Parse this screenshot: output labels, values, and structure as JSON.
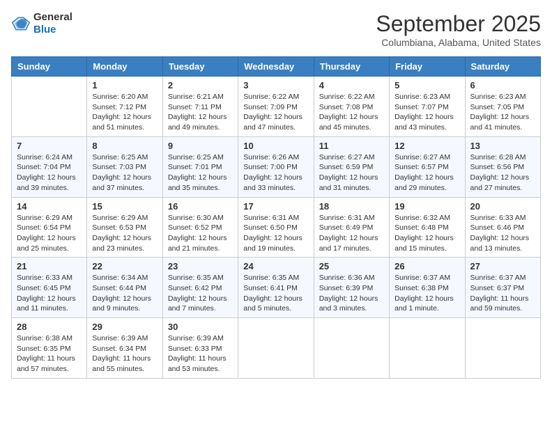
{
  "header": {
    "logo_line1": "General",
    "logo_line2": "Blue",
    "month_title": "September 2025",
    "location": "Columbiana, Alabama, United States"
  },
  "days_of_week": [
    "Sunday",
    "Monday",
    "Tuesday",
    "Wednesday",
    "Thursday",
    "Friday",
    "Saturday"
  ],
  "weeks": [
    [
      {
        "day": "",
        "info": ""
      },
      {
        "day": "1",
        "info": "Sunrise: 6:20 AM\nSunset: 7:12 PM\nDaylight: 12 hours\nand 51 minutes."
      },
      {
        "day": "2",
        "info": "Sunrise: 6:21 AM\nSunset: 7:11 PM\nDaylight: 12 hours\nand 49 minutes."
      },
      {
        "day": "3",
        "info": "Sunrise: 6:22 AM\nSunset: 7:09 PM\nDaylight: 12 hours\nand 47 minutes."
      },
      {
        "day": "4",
        "info": "Sunrise: 6:22 AM\nSunset: 7:08 PM\nDaylight: 12 hours\nand 45 minutes."
      },
      {
        "day": "5",
        "info": "Sunrise: 6:23 AM\nSunset: 7:07 PM\nDaylight: 12 hours\nand 43 minutes."
      },
      {
        "day": "6",
        "info": "Sunrise: 6:23 AM\nSunset: 7:05 PM\nDaylight: 12 hours\nand 41 minutes."
      }
    ],
    [
      {
        "day": "7",
        "info": "Sunrise: 6:24 AM\nSunset: 7:04 PM\nDaylight: 12 hours\nand 39 minutes."
      },
      {
        "day": "8",
        "info": "Sunrise: 6:25 AM\nSunset: 7:03 PM\nDaylight: 12 hours\nand 37 minutes."
      },
      {
        "day": "9",
        "info": "Sunrise: 6:25 AM\nSunset: 7:01 PM\nDaylight: 12 hours\nand 35 minutes."
      },
      {
        "day": "10",
        "info": "Sunrise: 6:26 AM\nSunset: 7:00 PM\nDaylight: 12 hours\nand 33 minutes."
      },
      {
        "day": "11",
        "info": "Sunrise: 6:27 AM\nSunset: 6:59 PM\nDaylight: 12 hours\nand 31 minutes."
      },
      {
        "day": "12",
        "info": "Sunrise: 6:27 AM\nSunset: 6:57 PM\nDaylight: 12 hours\nand 29 minutes."
      },
      {
        "day": "13",
        "info": "Sunrise: 6:28 AM\nSunset: 6:56 PM\nDaylight: 12 hours\nand 27 minutes."
      }
    ],
    [
      {
        "day": "14",
        "info": "Sunrise: 6:29 AM\nSunset: 6:54 PM\nDaylight: 12 hours\nand 25 minutes."
      },
      {
        "day": "15",
        "info": "Sunrise: 6:29 AM\nSunset: 6:53 PM\nDaylight: 12 hours\nand 23 minutes."
      },
      {
        "day": "16",
        "info": "Sunrise: 6:30 AM\nSunset: 6:52 PM\nDaylight: 12 hours\nand 21 minutes."
      },
      {
        "day": "17",
        "info": "Sunrise: 6:31 AM\nSunset: 6:50 PM\nDaylight: 12 hours\nand 19 minutes."
      },
      {
        "day": "18",
        "info": "Sunrise: 6:31 AM\nSunset: 6:49 PM\nDaylight: 12 hours\nand 17 minutes."
      },
      {
        "day": "19",
        "info": "Sunrise: 6:32 AM\nSunset: 6:48 PM\nDaylight: 12 hours\nand 15 minutes."
      },
      {
        "day": "20",
        "info": "Sunrise: 6:33 AM\nSunset: 6:46 PM\nDaylight: 12 hours\nand 13 minutes."
      }
    ],
    [
      {
        "day": "21",
        "info": "Sunrise: 6:33 AM\nSunset: 6:45 PM\nDaylight: 12 hours\nand 11 minutes."
      },
      {
        "day": "22",
        "info": "Sunrise: 6:34 AM\nSunset: 6:44 PM\nDaylight: 12 hours\nand 9 minutes."
      },
      {
        "day": "23",
        "info": "Sunrise: 6:35 AM\nSunset: 6:42 PM\nDaylight: 12 hours\nand 7 minutes."
      },
      {
        "day": "24",
        "info": "Sunrise: 6:35 AM\nSunset: 6:41 PM\nDaylight: 12 hours\nand 5 minutes."
      },
      {
        "day": "25",
        "info": "Sunrise: 6:36 AM\nSunset: 6:39 PM\nDaylight: 12 hours\nand 3 minutes."
      },
      {
        "day": "26",
        "info": "Sunrise: 6:37 AM\nSunset: 6:38 PM\nDaylight: 12 hours\nand 1 minute."
      },
      {
        "day": "27",
        "info": "Sunrise: 6:37 AM\nSunset: 6:37 PM\nDaylight: 11 hours\nand 59 minutes."
      }
    ],
    [
      {
        "day": "28",
        "info": "Sunrise: 6:38 AM\nSunset: 6:35 PM\nDaylight: 11 hours\nand 57 minutes."
      },
      {
        "day": "29",
        "info": "Sunrise: 6:39 AM\nSunset: 6:34 PM\nDaylight: 11 hours\nand 55 minutes."
      },
      {
        "day": "30",
        "info": "Sunrise: 6:39 AM\nSunset: 6:33 PM\nDaylight: 11 hours\nand 53 minutes."
      },
      {
        "day": "",
        "info": ""
      },
      {
        "day": "",
        "info": ""
      },
      {
        "day": "",
        "info": ""
      },
      {
        "day": "",
        "info": ""
      }
    ]
  ]
}
